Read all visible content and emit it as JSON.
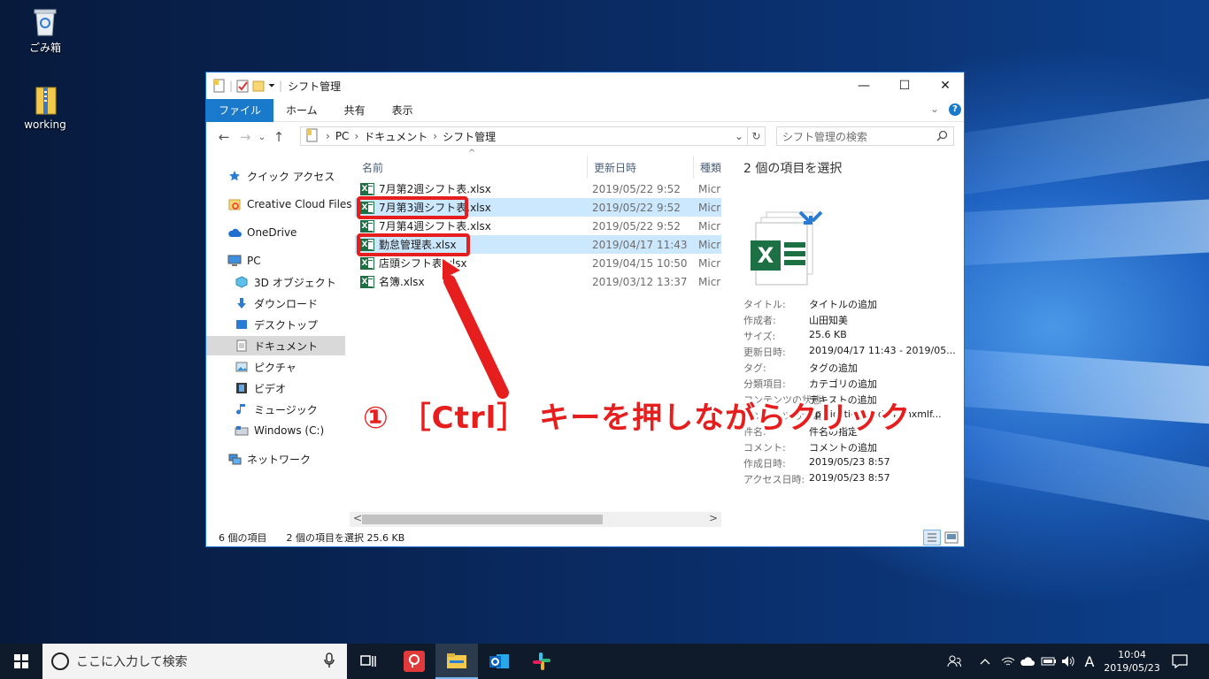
{
  "desktop": {
    "icons": [
      {
        "label": "ごみ箱",
        "icon": "recycle-bin-icon"
      },
      {
        "label": "working",
        "icon": "zip-folder-icon"
      }
    ]
  },
  "window": {
    "title": "シフト管理",
    "controls": {
      "minimize": "—",
      "maximize": "☐",
      "close": "✕"
    },
    "ribbon_tabs": [
      "ファイル",
      "ホーム",
      "共有",
      "表示"
    ],
    "ribbon_expand": "⌄",
    "help": "?",
    "address": {
      "back": "←",
      "forward": "→",
      "history": "⌄",
      "up": "↑",
      "crumbs": [
        "PC",
        "ドキュメント",
        "シフト管理"
      ],
      "sep": "›",
      "dropdown": "⌄",
      "refresh": "↻",
      "search_placeholder": "シフト管理の検索"
    },
    "nav": [
      {
        "label": "クイック アクセス",
        "icon": "star-icon"
      },
      {
        "label": "Creative Cloud Files",
        "icon": "creative-cloud-folder-icon"
      },
      {
        "label": "OneDrive",
        "icon": "cloud-icon"
      },
      {
        "label": "PC",
        "icon": "computer-icon"
      },
      {
        "label": "3D オブジェクト",
        "icon": "cube-icon"
      },
      {
        "label": "ダウンロード",
        "icon": "download-arrow-icon"
      },
      {
        "label": "デスクトップ",
        "icon": "desktop-folder-icon"
      },
      {
        "label": "ドキュメント",
        "icon": "document-icon"
      },
      {
        "label": "ピクチャ",
        "icon": "picture-icon"
      },
      {
        "label": "ビデオ",
        "icon": "film-icon"
      },
      {
        "label": "ミュージック",
        "icon": "music-note-icon"
      },
      {
        "label": "Windows (C:)",
        "icon": "drive-icon"
      },
      {
        "label": "ネットワーク",
        "icon": "network-icon"
      }
    ],
    "columns": {
      "name": "名前",
      "date": "更新日時",
      "type": "種類",
      "sort_indicator": "^"
    },
    "files": [
      {
        "name": "7月第2週シフト表.xlsx",
        "date": "2019/05/22 9:52",
        "type": "Micr",
        "selected": false
      },
      {
        "name": "7月第3週シフト表.xlsx",
        "date": "2019/05/22 9:52",
        "type": "Micr",
        "selected": true
      },
      {
        "name": "7月第4週シフト表.xlsx",
        "date": "2019/05/22 9:52",
        "type": "Micr",
        "selected": false
      },
      {
        "name": "勤怠管理表.xlsx",
        "date": "2019/04/17 11:43",
        "type": "Micr",
        "selected": true
      },
      {
        "name": "店頭シフト表.xlsx",
        "date": "2019/04/15 10:50",
        "type": "Micr",
        "selected": false
      },
      {
        "name": "名簿.xlsx",
        "date": "2019/03/12 13:37",
        "type": "Micr",
        "selected": false
      }
    ],
    "scroll": {
      "left": "<",
      "right": ">"
    },
    "details": {
      "heading": "2 個の項目を選択",
      "props": [
        {
          "k": "タイトル:",
          "v": "タイトルの追加"
        },
        {
          "k": "作成者:",
          "v": "山田知美"
        },
        {
          "k": "サイズ:",
          "v": "25.6 KB"
        },
        {
          "k": "更新日時:",
          "v": "2019/04/17 11:43 - 2019/05..."
        },
        {
          "k": "タグ:",
          "v": "タグの追加"
        },
        {
          "k": "分類項目:",
          "v": "カテゴリの追加"
        },
        {
          "k": "コンテンツの状態:",
          "v": "テキストの追加"
        },
        {
          "k": "コンテンツの種類:",
          "v": "application/vnd.openxmlf..."
        },
        {
          "k": "件名:",
          "v": "件名の指定"
        },
        {
          "k": "コメント:",
          "v": "コメントの追加"
        },
        {
          "k": "作成日時:",
          "v": "2019/05/23 8:57"
        },
        {
          "k": "アクセス日時:",
          "v": "2019/05/23 8:57"
        }
      ]
    },
    "status": {
      "count": "6 個の項目",
      "selection": "2 個の項目を選択  25.6 KB"
    }
  },
  "annotation": {
    "text": "① ［Ctrl］ キーを押しながらクリック",
    "color": "#e61e1e"
  },
  "taskbar": {
    "search_placeholder": "ここに入力して検索",
    "time": "10:04",
    "date": "2019/05/23",
    "ime": "A"
  }
}
